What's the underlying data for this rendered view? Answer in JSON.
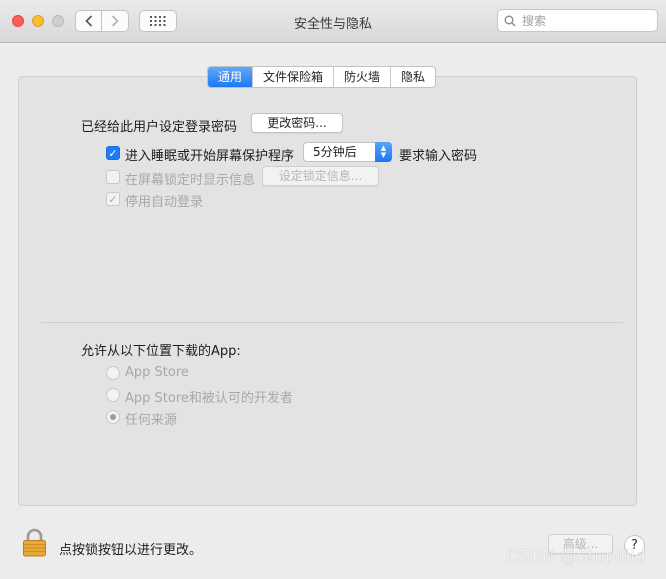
{
  "window": {
    "title": "安全性与隐私"
  },
  "toolbar": {
    "back_icon": "chevron-left-icon",
    "forward_icon": "chevron-right-icon",
    "show_all_icon": "grid-icon",
    "search_placeholder": "搜索"
  },
  "tabs": [
    {
      "label": "通用",
      "active": true
    },
    {
      "label": "文件保险箱",
      "active": false
    },
    {
      "label": "防火墙",
      "active": false
    },
    {
      "label": "隐私",
      "active": false
    }
  ],
  "general": {
    "password_set_label": "已经给此用户设定登录密码",
    "change_password_button": "更改密码...",
    "require_password": {
      "checked": true,
      "label": "进入睡眠或开始屏幕保护程序",
      "delay_value": "5分钟后",
      "suffix": "要求输入密码"
    },
    "show_message": {
      "checked": false,
      "enabled": false,
      "label": "在屏幕锁定时显示信息",
      "button": "设定锁定信息..."
    },
    "disable_auto_login": {
      "checked": true,
      "enabled": false,
      "label": "停用自动登录"
    }
  },
  "downloads": {
    "heading": "允许从以下位置下载的App:",
    "options": [
      {
        "label": "App Store",
        "selected": false
      },
      {
        "label": "App Store和被认可的开发者",
        "selected": false
      },
      {
        "label": "任何来源",
        "selected": true
      }
    ]
  },
  "footer": {
    "lock_label": "点按锁按钮以进行更改。",
    "advanced_button": "高级...",
    "help_label": "?"
  },
  "watermark": "CSDN @Stupiiiid",
  "colors": {
    "accent": "#1f7cf4",
    "close": "#fc5f57",
    "minimize": "#fdbc2e",
    "lock_body": "#e8a936"
  }
}
